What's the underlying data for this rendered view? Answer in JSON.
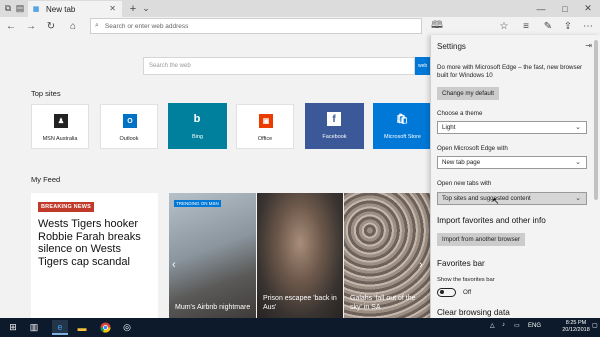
{
  "titlebar": {
    "tab_title": "New tab",
    "new_tab_icon": "plus-icon",
    "tab_actions_icon": "chevron-down-icon",
    "window_controls": [
      "minimize-icon",
      "maximize-icon",
      "close-icon"
    ]
  },
  "navbar": {
    "address_placeholder": "Search or enter web address",
    "buttons": [
      "back-icon",
      "forward-icon",
      "refresh-icon",
      "home-icon",
      "star-icon",
      "favorites-icon",
      "pen-icon",
      "share-icon",
      "more-icon"
    ]
  },
  "newtab": {
    "search_placeholder": "Search the web",
    "search_button": "web",
    "top_sites_title": "Top sites",
    "top_sites": [
      {
        "label": "MSN Australia",
        "color": "#ffffff"
      },
      {
        "label": "Outlook",
        "color": "#ffffff"
      },
      {
        "label": "Bing",
        "color": "#00809d"
      },
      {
        "label": "Office",
        "color": "#ffffff"
      },
      {
        "label": "Facebook",
        "color": "#3b5998"
      },
      {
        "label": "Microsoft Store",
        "color": "#0078d7"
      }
    ],
    "feed_title": "My Feed",
    "feed": {
      "badge": "BREAKING NEWS",
      "headline": "Wests Tigers hooker Robbie Farah breaks silence on Wests Tigers cap scandal",
      "trending": "TRENDING ON MSN",
      "stories": [
        {
          "caption": "Mum's Airbnb nightmare"
        },
        {
          "caption": "Prison escapee 'back in Aus'"
        },
        {
          "caption": "Galahs 'fall out of the sky' in SA"
        }
      ]
    }
  },
  "settings": {
    "title": "Settings",
    "promo": "Do more with Microsoft Edge – the fast, new browser built for Windows 10",
    "change_default": "Change my default",
    "theme_label": "Choose a theme",
    "theme_value": "Light",
    "open_with_label": "Open Microsoft Edge with",
    "open_with_value": "New tab page",
    "new_tabs_label": "Open new tabs with",
    "new_tabs_value": "Top sites and suggested content",
    "import_heading": "Import favorites and other info",
    "import_button": "Import from another browser",
    "favbar_heading": "Favorites bar",
    "favbar_label": "Show the favorites bar",
    "favbar_state": "Off",
    "clear_heading": "Clear browsing data"
  },
  "taskbar": {
    "language": "ENG",
    "time": "8:25 PM",
    "date": "20/12/2018",
    "apps": [
      "windows-start-icon",
      "task-view-icon",
      "edge-icon",
      "file-explorer-icon",
      "chrome-icon",
      "obs-icon"
    ]
  }
}
